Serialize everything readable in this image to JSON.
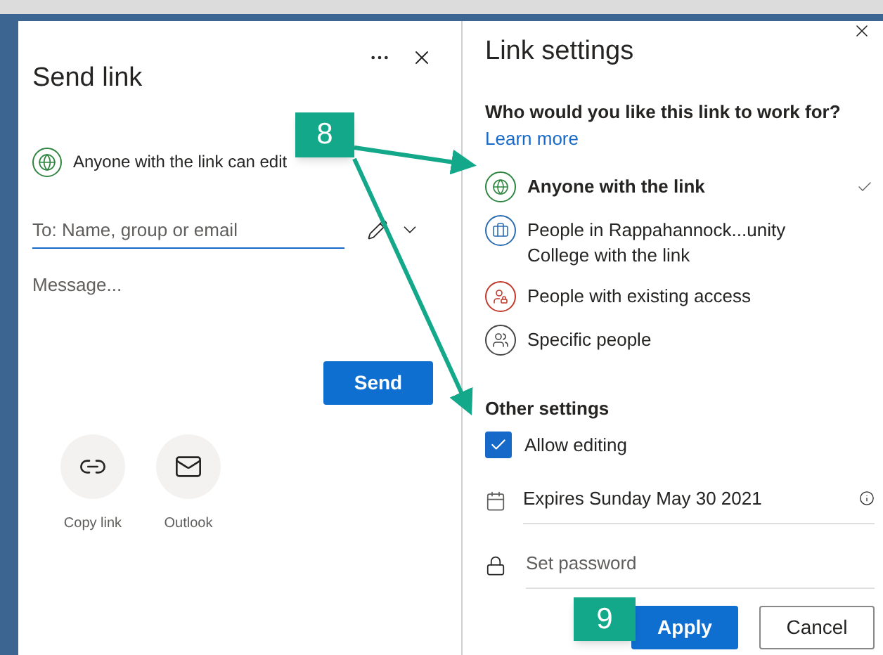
{
  "send_link": {
    "title": "Send link",
    "permission": "Anyone with the link can edit",
    "to_placeholder": "To: Name, group or email",
    "message_placeholder": "Message...",
    "send": "Send",
    "share_options": [
      {
        "kind": "copy_link",
        "label": "Copy link"
      },
      {
        "kind": "outlook",
        "label": "Outlook"
      }
    ]
  },
  "link_settings": {
    "title": "Link settings",
    "question": "Who would you like this link to work for?",
    "learn_more": "Learn more",
    "options": [
      {
        "kind": "globe",
        "label": "Anyone with the link",
        "color": "#2e8540",
        "selected": true
      },
      {
        "kind": "briefcase",
        "label": "People in Rappahannock...unity College with the link",
        "color": "#2b6cb0",
        "selected": false
      },
      {
        "kind": "lock_people",
        "label": "People with existing access",
        "color": "#c0392b",
        "selected": false
      },
      {
        "kind": "people",
        "label": "Specific people",
        "color": "#444444",
        "selected": false
      }
    ],
    "other_settings": "Other settings",
    "allow_editing": {
      "label": "Allow editing",
      "checked": true
    },
    "expires": "Expires Sunday May 30 2021",
    "password_placeholder": "Set password",
    "apply": "Apply",
    "cancel": "Cancel"
  },
  "callouts": [
    "8",
    "9"
  ]
}
